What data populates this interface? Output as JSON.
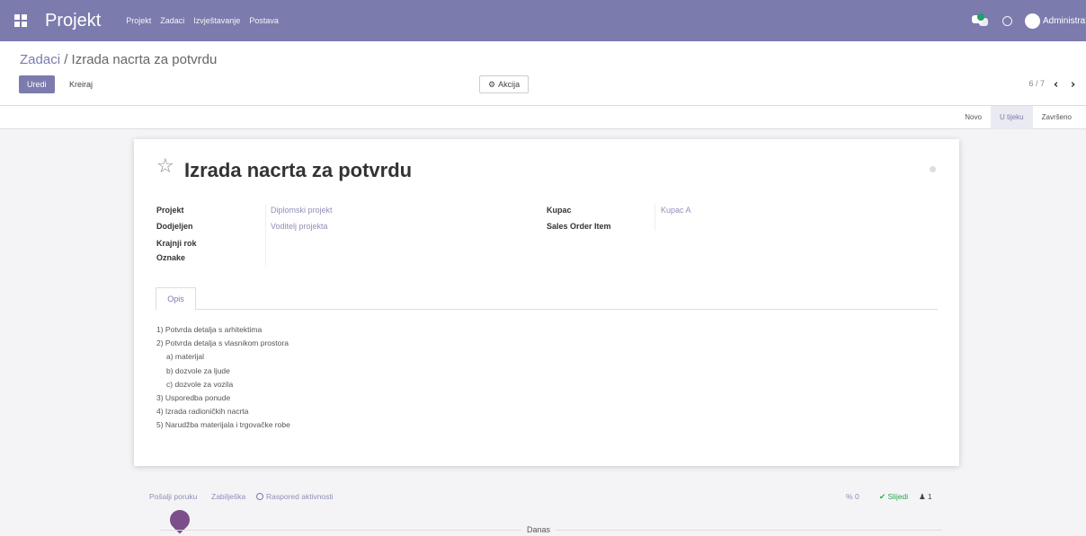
{
  "app": {
    "brand": "Projekt",
    "menu": [
      "Projekt",
      "Zadaci",
      "Izvještavanje",
      "Postava"
    ],
    "user": "Administrator"
  },
  "breadcrumb": {
    "parent": "Zadaci",
    "separator": " / ",
    "current": "Izrada nacrta za potvrdu"
  },
  "toolbar": {
    "edit_label": "Uredi",
    "create_label": "Kreiraj",
    "action_label": "Akcija"
  },
  "pager": {
    "value": "6 / 7"
  },
  "stages": [
    {
      "label": "Novo",
      "active": false
    },
    {
      "label": "U tijeku",
      "active": true
    },
    {
      "label": "Završeno",
      "active": false
    }
  ],
  "task": {
    "title": "Izrada nacrta za potvrdu",
    "fields": {
      "project_label": "Projekt",
      "project_value": "Diplomski projekt",
      "assigned_label": "Dodjeljen",
      "assigned_value": "Voditelj projekta",
      "deadline_label": "Krajnji rok",
      "tags_label": "Oznake",
      "customer_label": "Kupac",
      "customer_value": "Kupac A",
      "sale_item_label": "Sales Order Item"
    },
    "tab_label": "Opis",
    "description": [
      "1) Potvrda detalja s arhitektima",
      "2) Potvrda detalja s vlasnikom prostora",
      "a) materijal",
      "b) dozvole za ljude",
      "c) dozvole za vozila",
      "3) Usporedba ponude",
      "4) Izrada radioničkih nacrta",
      "5) Narudžba materijala i trgovačke robe"
    ]
  },
  "chatter": {
    "send_message": "Pošalji poruku",
    "log_note": "Zabilješka",
    "schedule_activity": "Raspored aktivnosti",
    "attachments": "0",
    "follow": "Slijedi",
    "followers": "1",
    "today": "Danas"
  },
  "colors": {
    "primary": "#7c7bad",
    "link": "#8f8fb8",
    "follow": "#28a745"
  }
}
